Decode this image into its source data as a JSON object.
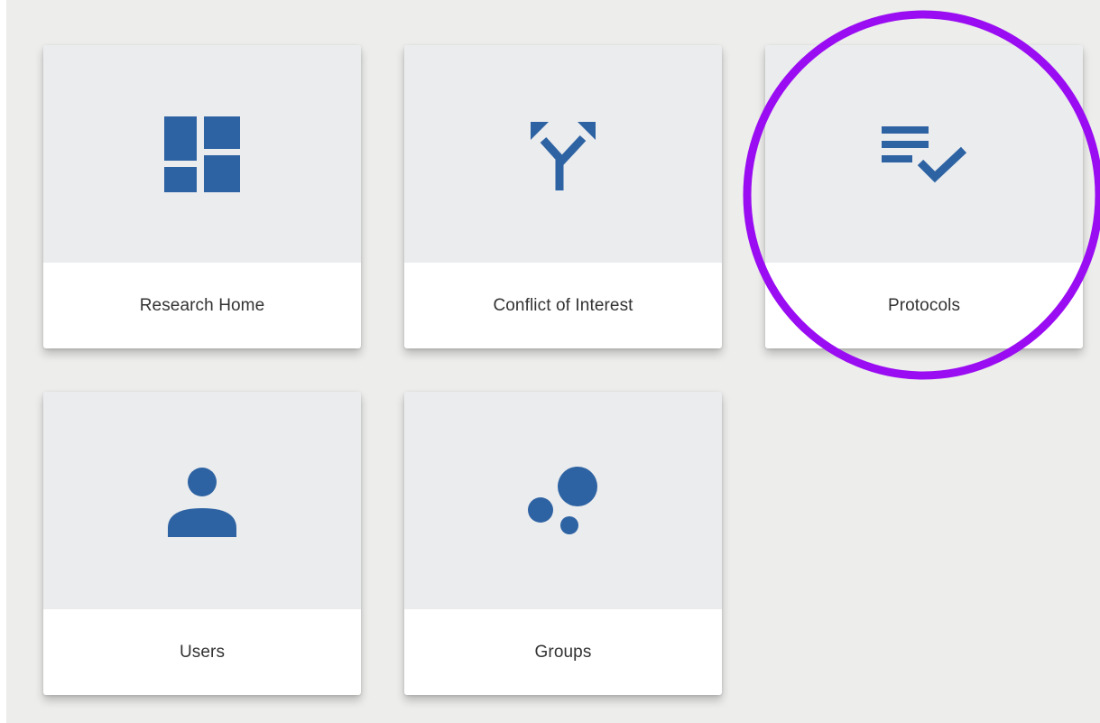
{
  "tiles": [
    {
      "label": "Research Home",
      "icon": "dashboard-icon"
    },
    {
      "label": "Conflict of Interest",
      "icon": "merge-arrows-icon"
    },
    {
      "label": "Protocols",
      "icon": "playlist-check-icon"
    },
    {
      "label": "Users",
      "icon": "person-icon"
    },
    {
      "label": "Groups",
      "icon": "bubbles-icon"
    }
  ],
  "colors": {
    "icon": "#2e63a3",
    "highlight": "#9a0df2",
    "tile_top": "#ebecee",
    "background": "#ededeb"
  }
}
